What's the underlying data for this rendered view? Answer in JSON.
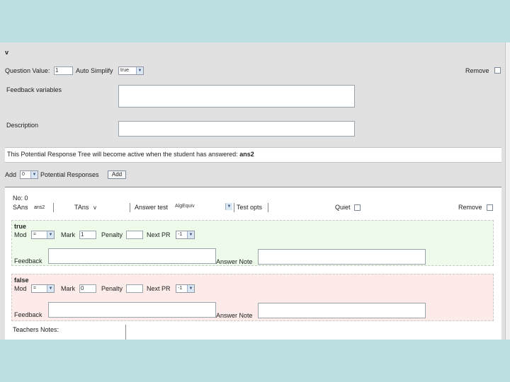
{
  "header": {
    "collapse_label": "v",
    "question_value_label": "Question Value:",
    "question_value": "1",
    "auto_simplify_label": "Auto Simplify",
    "auto_simplify_value": "true",
    "remove_label": "Remove"
  },
  "fields": {
    "feedback_variables_label": "Feedback variables",
    "feedback_variables_value": "",
    "description_label": "Description",
    "description_value": ""
  },
  "notice": {
    "text": "This Potential Response Tree will become active when the student has answered:",
    "answer_name": "ans2"
  },
  "add_row": {
    "add_label": "Add",
    "add_count": "0",
    "potential_responses_label": "Potential Responses",
    "add_button": "Add"
  },
  "node": {
    "title": "No: 0",
    "sans_label": "SAns",
    "sans_value": "ans2",
    "tans_label": "TAns",
    "tans_value": "v",
    "answer_test_label": "Answer test",
    "answer_test_value": "AlgEquiv",
    "test_opts_label": "Test opts",
    "quiet_label": "Quiet",
    "remove_label": "Remove",
    "teachers_notes_label": "Teachers Notes:"
  },
  "branches": {
    "true": {
      "title": "true",
      "mod_label": "Mod",
      "mod_value": "=",
      "mark_label": "Mark",
      "mark_value": "1",
      "penalty_label": "Penalty",
      "penalty_value": "",
      "next_pr_label": "Next PR",
      "next_pr_value": "-1",
      "feedback_label": "Feedback",
      "answer_note_label": "Answer Note"
    },
    "false": {
      "title": "false",
      "mod_label": "Mod",
      "mod_value": "=",
      "mark_label": "Mark",
      "mark_value": "0",
      "penalty_label": "Penalty",
      "penalty_value": "",
      "next_pr_label": "Next PR",
      "next_pr_value": "-1",
      "feedback_label": "Feedback",
      "answer_note_label": "Answer Note"
    }
  },
  "colors": {
    "page_background": "#bde0e3",
    "panel_background": "#e1e1e1",
    "true_branch_background": "#eefbea",
    "false_branch_background": "#fcebe9"
  }
}
